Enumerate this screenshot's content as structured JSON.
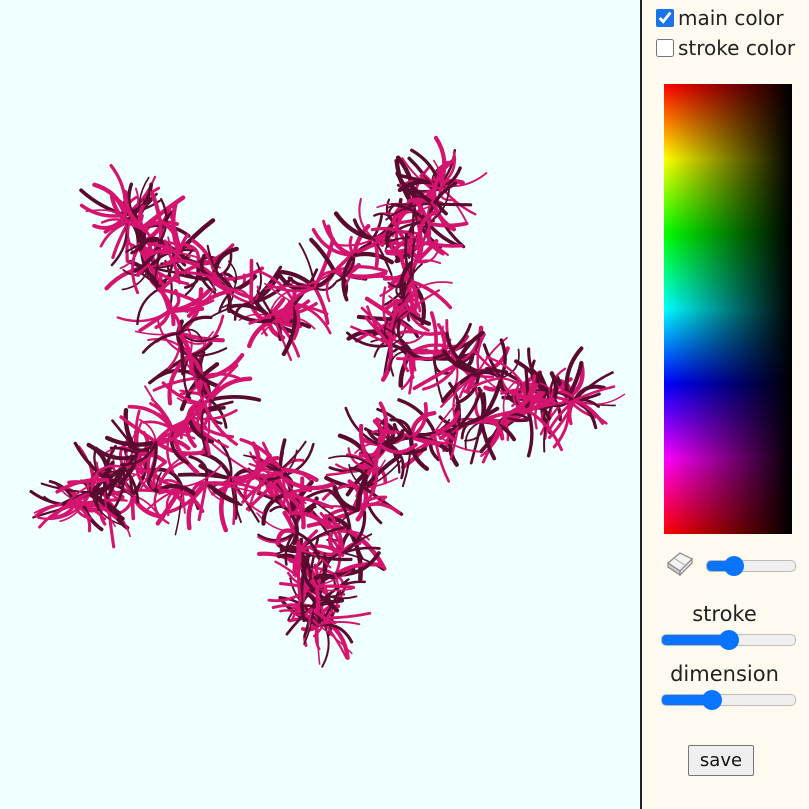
{
  "controls": {
    "main_color": {
      "label": "main color",
      "checked": true
    },
    "stroke_color": {
      "label": "stroke color",
      "checked": false
    },
    "eraser_icon": "eraser-icon",
    "eraser_slider": {
      "value": 25,
      "min": 0,
      "max": 100
    },
    "stroke": {
      "label": "stroke",
      "value": 50,
      "min": 0,
      "max": 100
    },
    "dimension": {
      "label": "dimension",
      "value": 35,
      "min": 0,
      "max": 100
    },
    "save_label": "save"
  },
  "colors": {
    "canvas_bg": "#f0ffff",
    "panel_bg": "#fffaef",
    "brush_main": "#d4146e",
    "brush_dark": "#5a0a2e",
    "accent": "#0a74ff"
  }
}
